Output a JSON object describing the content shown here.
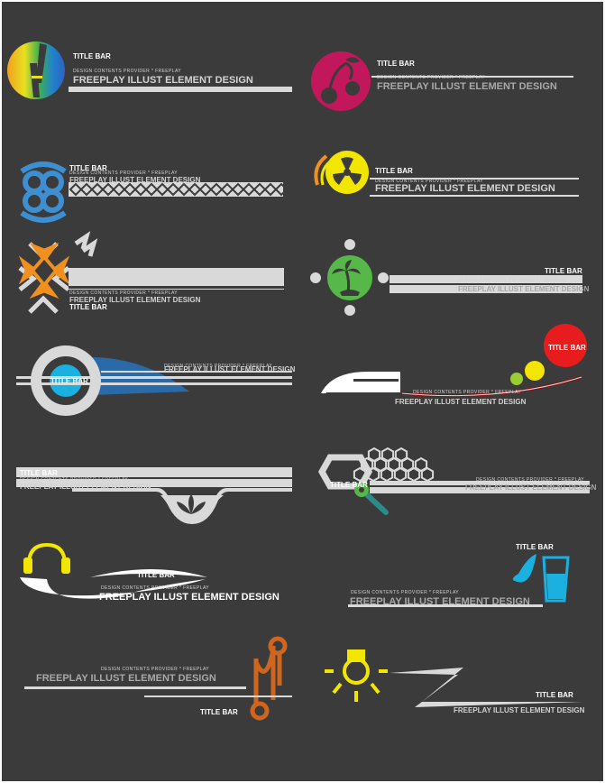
{
  "colors": {
    "background": "#3b3b3b",
    "frame": "#ffffff",
    "light": "#d9d9d9",
    "mid": "#a8a8a8",
    "crimson": "#c2185b",
    "yellow": "#f2e600",
    "orange": "#f0901e",
    "blue": "#3d8fd1",
    "cyan": "#1ab1e0",
    "green": "#55b848",
    "red": "#e81c1c",
    "lime": "#9acd32",
    "rust": "#d0661e",
    "teal": "#2d8a8a"
  },
  "icons": [
    "guitar-icon",
    "cherry-icon",
    "celtic-knot-icon",
    "radiation-icon",
    "snowflake-icon",
    "palm-island-icon",
    "ring-icon",
    "train-icon",
    "lotus-icon",
    "wrench-icon",
    "headphones-icon",
    "water-glass-icon",
    "thermometer-icon",
    "light-bulb-icon",
    "lightning-icon"
  ],
  "tiles": [
    {
      "title": "TITLE BAR",
      "sub": "DESIGN CONTENTS PROVIDER * FREEPLAY",
      "main": "FREEPLAY ILLUST ELEMENT DESIGN"
    },
    {
      "title": "TITLE BAR",
      "sub": "DESIGN CONTENTS PROVIDER * FREEPLAY",
      "main": "FREEPLAY ILLUST ELEMENT DESIGN"
    },
    {
      "title": "TITLE BAR",
      "sub": "DESIGN CONTENTS PROVIDER * FREEPLAY",
      "main": "FREEPLAY ILLUST ELEMENT DESIGN"
    },
    {
      "title": "TITLE BAR",
      "sub": "DESIGN CONTENTS PROVIDER * FREEPLAY",
      "main": "FREEPLAY ILLUST ELEMENT DESIGN"
    },
    {
      "title": "TITLE BAR",
      "sub": "DESIGN CONTENTS PROVIDER * FREEPLAY",
      "main": "FREEPLAY ILLUST ELEMENT DESIGN"
    },
    {
      "title": "TITLE BAR",
      "sub": "DESIGN CONTENTS PROVIDER * FREEPLAY",
      "main": "FREEPLAY ILLUST ELEMENT DESIGN"
    },
    {
      "title": "TITLE BAR",
      "sub": "DESIGN CONTENTS PROVIDER * FREEPLAY",
      "main": "FREEPLAY ILLUST ELEMENT DESIGN"
    },
    {
      "title": "TITLE BAR",
      "sub": "DESIGN CONTENTS PROVIDER * FREEPLAY",
      "main": "FREEPLAY ILLUST ELEMENT DESIGN"
    },
    {
      "title": "TITLE BAR",
      "sub": "DESIGN CONTENTS PROVIDER * FREEPLAY",
      "main": "FREEPLAY ILLUST ELEMENT DESIGN"
    },
    {
      "title": "TITLE BAR",
      "sub": "DESIGN CONTENTS PROVIDER * FREEPLAY",
      "main": "FREEPLAY ILLUST ELEMENT DESIGN"
    },
    {
      "title": "TITLE BAR",
      "sub": "DESIGN CONTENTS PROVIDER * FREEPLAY",
      "main": "FREEPLAY ILLUST ELEMENT DESIGN"
    },
    {
      "title": "TITLE BAR",
      "sub": "DESIGN CONTENTS PROVIDER * FREEPLAY",
      "main": "FREEPLAY ILLUST ELEMENT DESIGN"
    },
    {
      "title": "TITLE BAR",
      "sub": "DESIGN CONTENTS PROVIDER * FREEPLAY",
      "main": "FREEPLAY ILLUST ELEMENT DESIGN"
    },
    {
      "title": "TITLE BAR",
      "sub": "",
      "main": "FREEPLAY ILLUST ELEMENT DESIGN"
    }
  ]
}
